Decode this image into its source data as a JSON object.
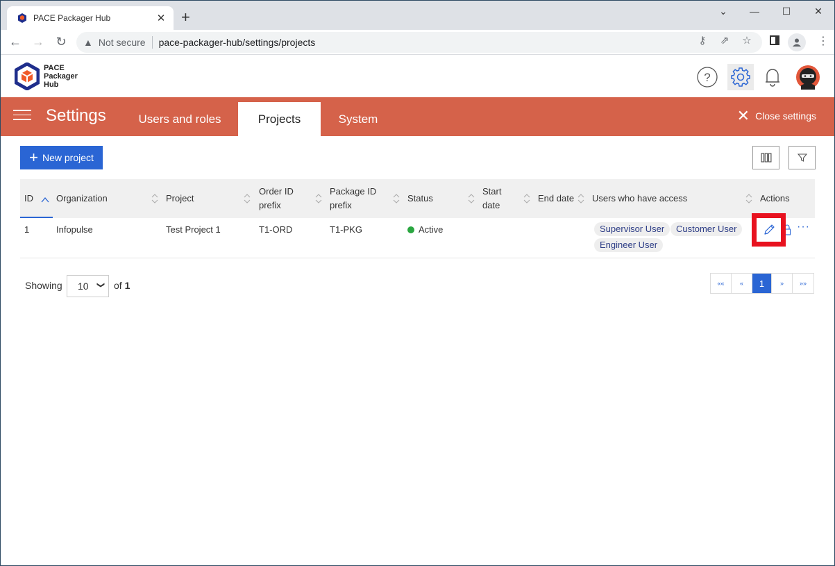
{
  "browser": {
    "tab_title": "PACE Packager Hub",
    "tab_close": "✕",
    "new_tab": "+",
    "security_label": "Not secure",
    "url": "pace-packager-hub/settings/projects"
  },
  "app": {
    "logo_lines": [
      "PACE",
      "Packager",
      "Hub"
    ]
  },
  "settings": {
    "title": "Settings",
    "tabs": [
      {
        "label": "Users and roles",
        "active": false
      },
      {
        "label": "Projects",
        "active": true
      },
      {
        "label": "System",
        "active": false
      }
    ],
    "close_label": "Close settings"
  },
  "toolbar": {
    "new_project_label": "New project"
  },
  "table": {
    "columns": [
      {
        "label": "ID",
        "sorted": "asc"
      },
      {
        "label": "Organization"
      },
      {
        "label": "Project"
      },
      {
        "label": "Order ID prefix"
      },
      {
        "label": "Package ID prefix"
      },
      {
        "label": "Status"
      },
      {
        "label": "Start date"
      },
      {
        "label": "End date"
      },
      {
        "label": "Users who have access"
      },
      {
        "label": "Actions"
      }
    ],
    "rows": [
      {
        "id": "1",
        "organization": "Infopulse",
        "project": "Test Project 1",
        "order_prefix": "T1-ORD",
        "package_prefix": "T1-PKG",
        "status": "Active",
        "status_color": "#2aa640",
        "start_date": "",
        "end_date": "",
        "users": [
          "Supervisor User",
          "Customer User",
          "Engineer User"
        ]
      }
    ]
  },
  "pagination": {
    "showing_label": "Showing",
    "page_size": "10",
    "of_label": "of",
    "total_pages": "1",
    "current_page": "1",
    "first": "««",
    "prev": "«",
    "next": "»",
    "last": "»»"
  },
  "colors": {
    "accent": "#2a65d4",
    "settings_bar": "#d5624a",
    "highlight": "#e8121f"
  }
}
